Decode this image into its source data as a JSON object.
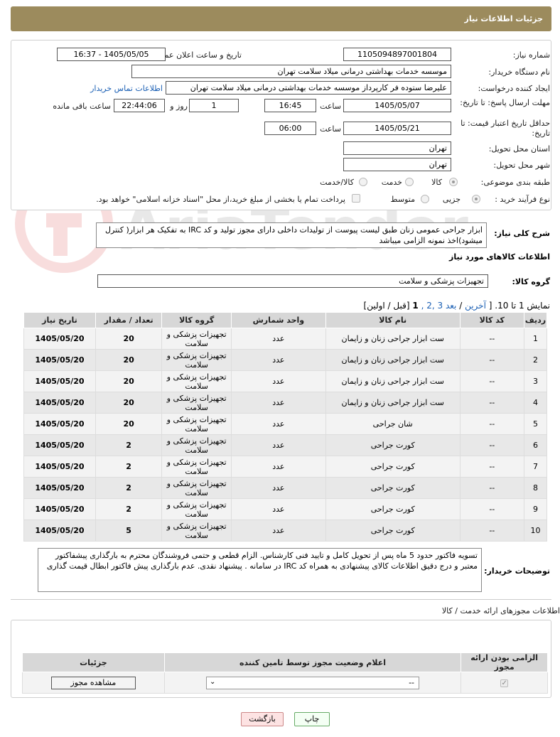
{
  "header": {
    "title": "جزئیات اطلاعات نیاز"
  },
  "form": {
    "need_number_label": "شماره نیاز:",
    "need_number": "1105094897001804",
    "announce_label": "تاریخ و ساعت اعلان عمومی:",
    "announce_value": "1405/05/05 - 16:37",
    "buyer_org_label": "نام دستگاه خریدار:",
    "buyer_org": "موسسه خدمات بهداشتی درمانی میلاد سلامت تهران",
    "creator_label": "ایجاد کننده درخواست:",
    "creator": "علیرضا ستوده فر کارپرداز موسسه خدمات بهداشتی درمانی میلاد سلامت تهران",
    "contact_link": "اطلاعات تماس خریدار",
    "reply_deadline_label": "مهلت ارسال پاسخ: تا تاریخ:",
    "reply_date": "1405/05/07",
    "time_label": "ساعت",
    "reply_time": "16:45",
    "days_value": "1",
    "days_label": "روز و",
    "remaining_time": "22:44:06",
    "remaining_label": "ساعت باقی مانده",
    "price_deadline_label": "حداقل تاریخ اعتبار قیمت: تا تاریخ:",
    "price_date": "1405/05/21",
    "price_time": "06:00",
    "province_label": "استان محل تحویل:",
    "province": "تهران",
    "city_label": "شهر محل تحویل:",
    "city": "تهران",
    "category_label": "طبقه بندی موضوعی:",
    "category_options": [
      "کالا",
      "خدمت",
      "کالا/خدمت"
    ],
    "process_label": "نوع فرآیند خرید :",
    "process_options": [
      "جزیی",
      "متوسط"
    ],
    "payment_note": "پرداخت تمام یا بخشی از مبلغ خرید،از محل \"اسناد خزانه اسلامی\" خواهد بود."
  },
  "summary": {
    "label": "شرح کلی نیاز:",
    "text": "ابزار جراحی عمومی زنان طبق لیست پیوست از تولیدات داخلی دارای مجوز تولید و کد IRC به تفکیک هر ابزار( کنترل میشود)اخذ نمونه الزامی میباشد"
  },
  "goods": {
    "section_title": "اطلاعات کالاهای مورد نیاز",
    "group_label": "گروه کالا:",
    "group_value": "تجهیزات پزشکی و سلامت",
    "pager": {
      "prefix": "نمایش 1 تا 10. [",
      "last": "آخرین",
      "next": "بعد",
      "pages": "3 ,2 ,",
      "current": "1",
      "suffix": "[قبل / اولین]"
    },
    "columns": [
      "ردیف",
      "کد کالا",
      "نام کالا",
      "واحد شمارش",
      "گروه کالا",
      "تعداد / مقدار",
      "تاریخ نیاز"
    ],
    "rows": [
      {
        "n": "1",
        "code": "--",
        "name": "ست ابزار جراحی زنان و زایمان",
        "unit": "عدد",
        "group": "تجهیزات پزشکی و سلامت",
        "qty": "20",
        "date": "1405/05/20"
      },
      {
        "n": "2",
        "code": "--",
        "name": "ست ابزار جراحی زنان و زایمان",
        "unit": "عدد",
        "group": "تجهیزات پزشکی و سلامت",
        "qty": "20",
        "date": "1405/05/20"
      },
      {
        "n": "3",
        "code": "--",
        "name": "ست ابزار جراحی زنان و زایمان",
        "unit": "عدد",
        "group": "تجهیزات پزشکی و سلامت",
        "qty": "20",
        "date": "1405/05/20"
      },
      {
        "n": "4",
        "code": "--",
        "name": "ست ابزار جراحی زنان و زایمان",
        "unit": "عدد",
        "group": "تجهیزات پزشکی و سلامت",
        "qty": "20",
        "date": "1405/05/20"
      },
      {
        "n": "5",
        "code": "--",
        "name": "شان جراحی",
        "unit": "عدد",
        "group": "تجهیزات پزشکی و سلامت",
        "qty": "20",
        "date": "1405/05/20"
      },
      {
        "n": "6",
        "code": "--",
        "name": "کورت جراحی",
        "unit": "عدد",
        "group": "تجهیزات پزشکی و سلامت",
        "qty": "2",
        "date": "1405/05/20"
      },
      {
        "n": "7",
        "code": "--",
        "name": "کورت جراحی",
        "unit": "عدد",
        "group": "تجهیزات پزشکی و سلامت",
        "qty": "2",
        "date": "1405/05/20"
      },
      {
        "n": "8",
        "code": "--",
        "name": "کورت جراحی",
        "unit": "عدد",
        "group": "تجهیزات پزشکی و سلامت",
        "qty": "2",
        "date": "1405/05/20"
      },
      {
        "n": "9",
        "code": "--",
        "name": "کورت جراحی",
        "unit": "عدد",
        "group": "تجهیزات پزشکی و سلامت",
        "qty": "2",
        "date": "1405/05/20"
      },
      {
        "n": "10",
        "code": "--",
        "name": "کورت جراحی",
        "unit": "عدد",
        "group": "تجهیزات پزشکی و سلامت",
        "qty": "5",
        "date": "1405/05/20"
      }
    ]
  },
  "buyer_notes": {
    "label": "توضیحات خریدار:",
    "text": "تسویه فاکتور حدود 5 ماه پس از تحویل کامل و تایید فنی کارشناس. الزام قطعی و حتمی فروشندگان محترم به بارگذاری پیشفاکتور معتبر و درج دقیق اطلاعات کالای پیشنهادی به همراه کد IRC  در سامانه . پیشنهاد نقدی. عدم بارگذاری پیش فاکتور ابطال قیمت گذاری"
  },
  "permits": {
    "title": "اطلاعات مجوزهای ارائه خدمت / کالا",
    "columns": [
      "الزامی بودن ارائه مجوز",
      "اعلام وضعیت مجوز توسط تامین کننده",
      "جزئیات"
    ],
    "select_value": "--",
    "view_button": "مشاهده مجوز"
  },
  "footer": {
    "print": "چاپ",
    "back": "بازگشت"
  },
  "watermark_text": "AriaTender.neT",
  "colors": {
    "title_bar": "#9c8b5d",
    "link": "#1a5fb4",
    "back_button": "#fde3e3"
  }
}
